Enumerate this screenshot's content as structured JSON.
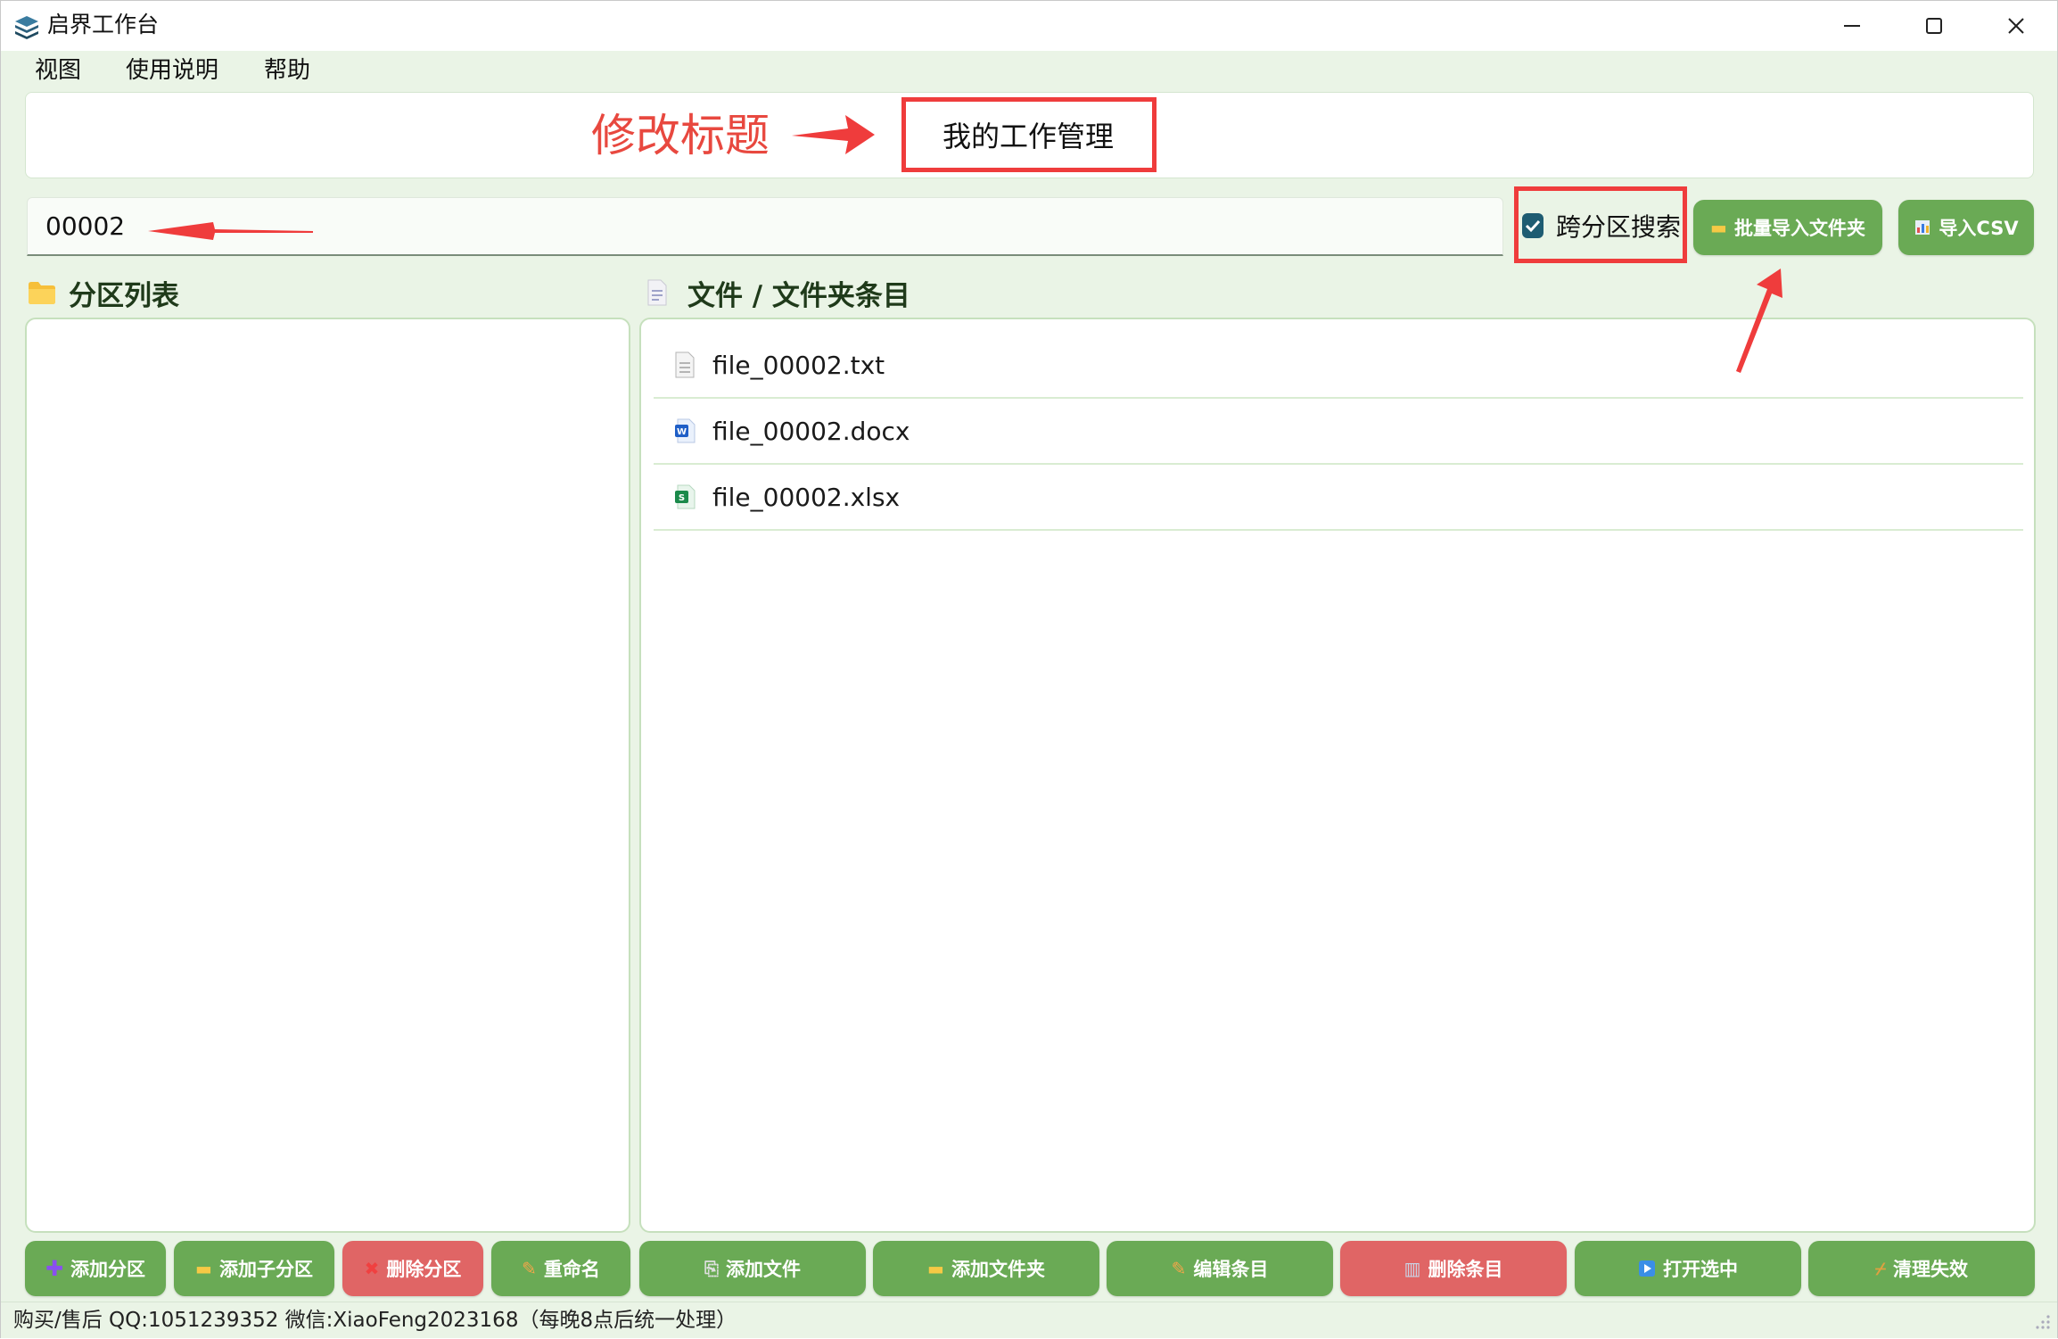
{
  "window": {
    "title": "启界工作台",
    "minimize_icon": "minimize-icon",
    "maximize_icon": "maximize-icon",
    "close_icon": "close-icon"
  },
  "menu": {
    "items": [
      "视图",
      "使用说明",
      "帮助"
    ]
  },
  "annotation": {
    "label": "修改标题",
    "color": "#ef3c3c"
  },
  "header": {
    "title": "我的工作管理"
  },
  "search": {
    "value": "00002",
    "cross_partition_label": "跨分区搜索",
    "cross_partition_checked": true
  },
  "toolbar": {
    "batch_import_label": "批量导入文件夹",
    "import_csv_label": "导入CSV"
  },
  "partition_list": {
    "heading": "分区列表",
    "items": []
  },
  "entries": {
    "heading": "文件 / 文件夹条目",
    "items": [
      {
        "name": "file_00002.txt",
        "icon": "text-file-icon"
      },
      {
        "name": "file_00002.docx",
        "icon": "word-file-icon"
      },
      {
        "name": "file_00002.xlsx",
        "icon": "excel-file-icon"
      }
    ]
  },
  "partition_buttons": {
    "add": "添加分区",
    "add_sub": "添加子分区",
    "delete": "删除分区",
    "rename": "重命名"
  },
  "entry_buttons": {
    "add_file": "添加文件",
    "add_folder": "添加文件夹",
    "edit": "编辑条目",
    "delete": "删除条目",
    "open": "打开选中",
    "clean": "清理失效"
  },
  "status": {
    "text": "购买/售后 QQ:1051239352 微信:XiaoFeng2023168（每晚8点后统一处理）"
  },
  "colors": {
    "accent_green": "#6aaa55",
    "danger_red": "#e06565",
    "background": "#eaf4e6"
  }
}
